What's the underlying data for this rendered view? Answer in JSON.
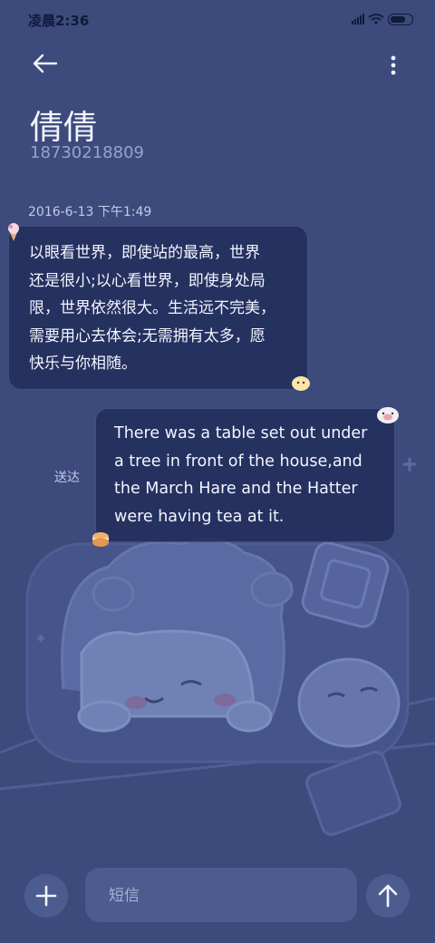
{
  "status_bar": {
    "time": "凌晨2:36",
    "icons": [
      "signal-icon",
      "wifi-icon",
      "battery-icon"
    ]
  },
  "header": {
    "back_icon": "back-arrow-icon",
    "more_icon": "more-vertical-icon",
    "contact_name": "倩倩",
    "contact_phone": "18730218809"
  },
  "conversation": {
    "timestamp": "2016-6-13 下午1:49",
    "messages": [
      {
        "direction": "incoming",
        "lines": [
          "以眼看世界，即使站的最高，世界",
          "还是很小;以心看世界，即使身处局",
          "限，世界依然很大。生活远不完美，",
          "需要用心去体会;无需拥有太多，愿",
          "快乐与你相随。"
        ]
      },
      {
        "direction": "outgoing",
        "status": "送达",
        "lines": [
          "There was a table set out under",
          "a tree in front of the house,and",
          "the March Hare and the Hatter",
          "were having tea at it."
        ]
      }
    ]
  },
  "composer": {
    "placeholder": "短信",
    "add_icon": "plus-icon",
    "send_icon": "send-arrow-icon"
  },
  "colors": {
    "background": "#3c4a7c",
    "bubble": "#242f5c",
    "text": "#f3f5ff",
    "muted": "#98a3cc"
  }
}
